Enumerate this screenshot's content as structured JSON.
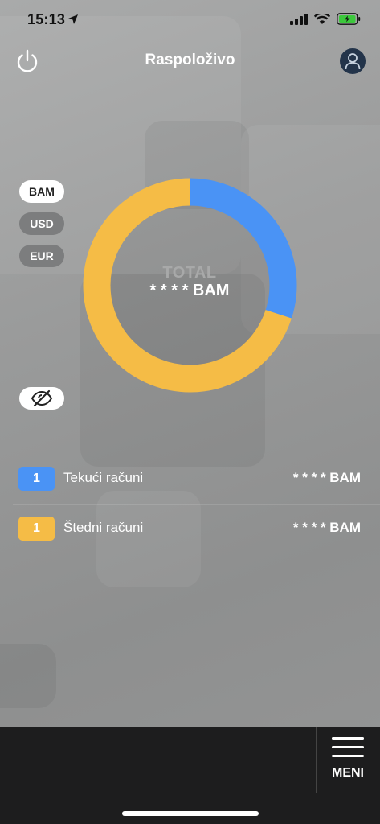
{
  "status_bar": {
    "time": "15:13",
    "icons": [
      "location-arrow-icon",
      "cellular-signal-icon",
      "wifi-icon",
      "battery-charging-icon"
    ]
  },
  "header": {
    "title": "Raspoloživo",
    "left_icon": "power-icon",
    "right_icon": "user-avatar-icon"
  },
  "currency_selector": {
    "options": [
      "BAM",
      "USD",
      "EUR"
    ],
    "selected": "BAM"
  },
  "visibility_toggle": {
    "icon": "eye-slash-icon"
  },
  "chart_data": {
    "type": "pie",
    "style": "donut",
    "center_label": "TOTAL",
    "center_value": "* * * * BAM",
    "slices": [
      {
        "label": "Tekući računi",
        "fraction": 0.3,
        "color": "#4a93f5"
      },
      {
        "label": "Štedni računi",
        "fraction": 0.7,
        "color": "#f5bc46"
      }
    ]
  },
  "accounts": [
    {
      "count": "1",
      "label": "Tekući računi",
      "amount": "* * * * BAM",
      "color": "#4a93f5"
    },
    {
      "count": "1",
      "label": "Štedni računi",
      "amount": "* * * * BAM",
      "color": "#f5bc46"
    }
  ],
  "bottom_bar": {
    "menu_label": "MENI",
    "menu_icon": "hamburger-menu-icon"
  },
  "colors": {
    "blue": "#4a93f5",
    "yellow": "#f5bc46",
    "bottom_bar": "#1d1d1e",
    "avatar_bg": "#23344a"
  }
}
